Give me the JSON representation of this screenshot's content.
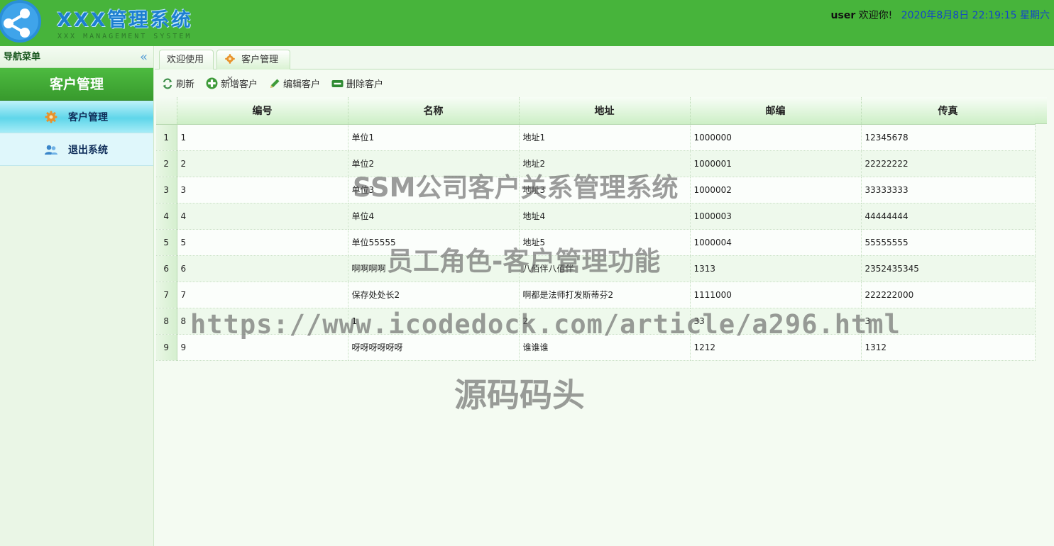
{
  "header": {
    "logo_title": "XXX管理系统",
    "logo_subtitle": "XXX MANAGEMENT SYSTEM",
    "username": "user",
    "welcome": "欢迎你!",
    "datetime": "2020年8月8日 22:19:15 星期六",
    "bg_color": "#47b43b"
  },
  "sidebar": {
    "title": "导航菜单",
    "collapse_glyph": "«",
    "section": "客户管理",
    "items": [
      {
        "label": "客户管理",
        "icon": "gear-icon",
        "active": true
      },
      {
        "label": "退出系统",
        "icon": "users-icon",
        "active": false
      }
    ]
  },
  "tabs": [
    {
      "label": "欢迎使用"
    },
    {
      "label": "客户管理",
      "icon": "gear-icon",
      "close": "×"
    }
  ],
  "toolbar": {
    "refresh": "刷新",
    "add": "新增客户",
    "edit": "编辑客户",
    "delete": "删除客户"
  },
  "table": {
    "columns": [
      "编号",
      "名称",
      "地址",
      "邮编",
      "传真"
    ],
    "rows": [
      [
        "1",
        "1",
        "单位1",
        "地址1",
        "1000000",
        "12345678"
      ],
      [
        "2",
        "2",
        "单位2",
        "地址2",
        "1000001",
        "22222222"
      ],
      [
        "3",
        "3",
        "单位3",
        "地址3",
        "1000002",
        "33333333"
      ],
      [
        "4",
        "4",
        "单位4",
        "地址4",
        "1000003",
        "44444444"
      ],
      [
        "5",
        "5",
        "单位55555",
        "地址5",
        "1000004",
        "55555555"
      ],
      [
        "6",
        "6",
        "啊啊啊啊",
        "八佰伴八佰伴",
        "1313",
        "2352435345"
      ],
      [
        "7",
        "7",
        "保存处处长2",
        "啊都是法师打发斯蒂芬2",
        "1111000",
        "222222000"
      ],
      [
        "8",
        "8",
        "1",
        "2",
        "33",
        "3"
      ],
      [
        "9",
        "9",
        "呀呀呀呀呀呀",
        "谁谁谁",
        "1212",
        "1312"
      ]
    ]
  },
  "watermarks": {
    "line1": "SSM公司客户关系管理系统",
    "line2": "员工角色-客户管理功能",
    "line3": "https://www.icodedock.com/article/a296.html",
    "line4": "源码码头"
  }
}
